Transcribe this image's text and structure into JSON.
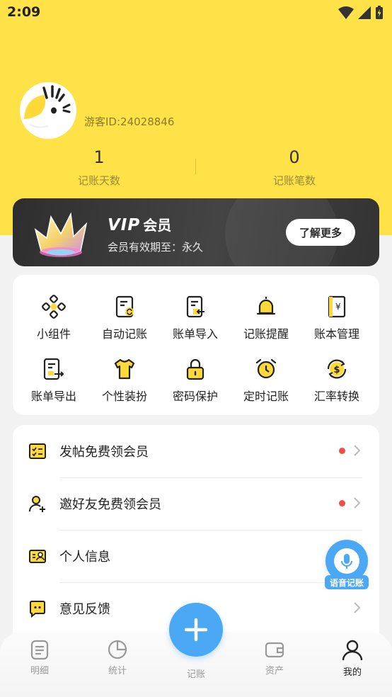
{
  "status_bar": {
    "time": "2:09"
  },
  "profile": {
    "guest_id": "游客ID:24028846",
    "stats": [
      {
        "value": "1",
        "label": "记账天数"
      },
      {
        "value": "0",
        "label": "记账笔数"
      }
    ]
  },
  "vip": {
    "title_prefix": "VIP",
    "title": "会员",
    "subtitle": "会员有效期至：永久",
    "button_label": "了解更多"
  },
  "tools": [
    {
      "label": "小组件",
      "icon": "widget-icon"
    },
    {
      "label": "自动记账",
      "icon": "auto-bookkeeping-icon"
    },
    {
      "label": "账单导入",
      "icon": "bill-import-icon"
    },
    {
      "label": "记账提醒",
      "icon": "bell-icon"
    },
    {
      "label": "账本管理",
      "icon": "ledger-icon"
    },
    {
      "label": "账单导出",
      "icon": "bill-export-icon"
    },
    {
      "label": "个性装扮",
      "icon": "tshirt-icon"
    },
    {
      "label": "密码保护",
      "icon": "lock-icon"
    },
    {
      "label": "定时记账",
      "icon": "alarm-clock-icon"
    },
    {
      "label": "汇率转换",
      "icon": "currency-exchange-icon"
    }
  ],
  "menu": [
    {
      "label": "发帖免费领会员",
      "icon": "checklist-icon",
      "badge": true
    },
    {
      "label": "邀好友免费领会员",
      "icon": "add-user-icon",
      "badge": true
    },
    {
      "label": "个人信息",
      "icon": "id-card-icon",
      "badge": false
    },
    {
      "label": "意见反馈",
      "icon": "feedback-icon",
      "badge": false
    }
  ],
  "voice": {
    "label": "语音记账"
  },
  "tabbar": {
    "items": [
      {
        "label": "明细",
        "icon": "details-icon"
      },
      {
        "label": "统计",
        "icon": "pie-chart-icon"
      },
      {
        "label": "记账",
        "icon": "plus-icon"
      },
      {
        "label": "资产",
        "icon": "wallet-icon"
      },
      {
        "label": "我的",
        "icon": "user-icon"
      }
    ],
    "active": "我的"
  },
  "colors": {
    "accent_yellow": "#ffe247",
    "accent_blue": "#4aa8f5",
    "badge_red": "#f24e43"
  }
}
